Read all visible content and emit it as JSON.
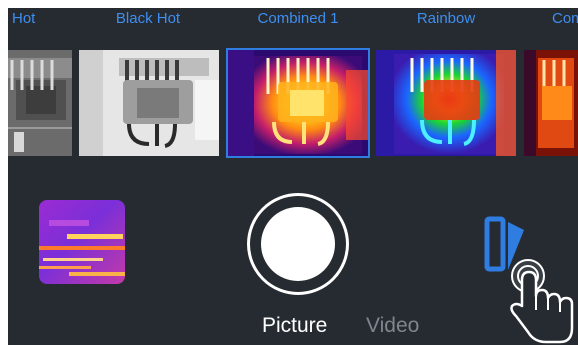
{
  "palettes": [
    {
      "label": "Hot",
      "selected": false
    },
    {
      "label": "Black Hot",
      "selected": false
    },
    {
      "label": "Combined 1",
      "selected": true
    },
    {
      "label": "Rainbow",
      "selected": false
    },
    {
      "label": "Com",
      "selected": false
    }
  ],
  "modes": {
    "picture": "Picture",
    "video": "Video",
    "active": "Picture"
  },
  "icons": {
    "gallery": "gallery-thumbnail-icon",
    "shutter": "shutter-icon",
    "toggle": "camera-switch-icon",
    "gesture": "tap-hand-icon"
  },
  "colors": {
    "background": "#262b31",
    "accent": "#3e8ef0",
    "selection": "#2f7de1",
    "mode_active": "#ffffff",
    "mode_inactive": "#80858c"
  }
}
